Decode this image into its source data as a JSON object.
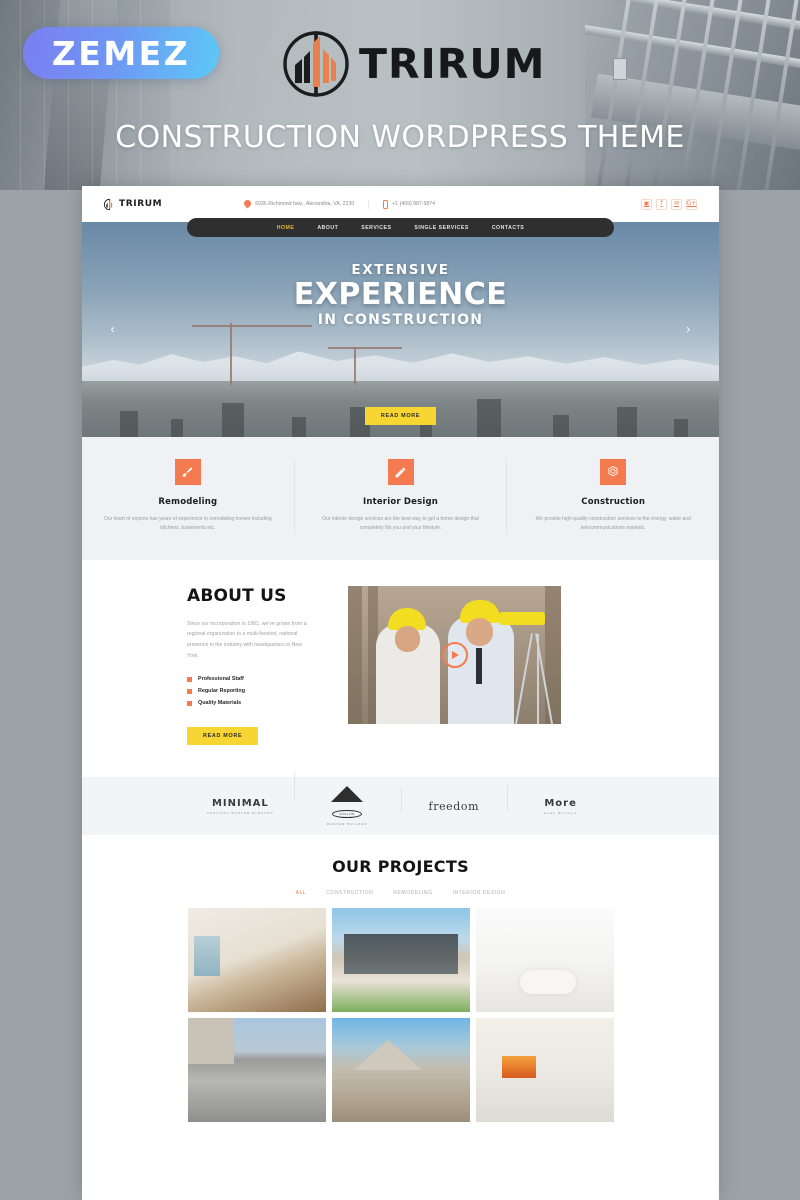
{
  "banner": {
    "vendor_badge": "ZEMEZ",
    "brand": "TRIRUM",
    "tagline": "CONSTRUCTION WORDPRESS THEME",
    "colors": {
      "badge_start": "#7B7EF0",
      "badge_end": "#5DC8F5",
      "brand_accent": "#E8814E"
    }
  },
  "site": {
    "logo_text": "TRIRUM",
    "topbar": {
      "address": "6036 Richmond hwy., Alexandria, VA, 2230",
      "phone": "+1 (409) 987-5874",
      "address_icon": "map-pin-icon",
      "phone_icon": "phone-icon",
      "socials": [
        {
          "name": "instagram-icon",
          "glyph": "▣"
        },
        {
          "name": "facebook-icon",
          "glyph": "f"
        },
        {
          "name": "twitter-icon",
          "glyph": "✉"
        },
        {
          "name": "google-plus-icon",
          "glyph": "G+"
        }
      ]
    },
    "nav": [
      {
        "label": "HOME",
        "active": true
      },
      {
        "label": "ABOUT",
        "active": false
      },
      {
        "label": "SERVICES",
        "active": false
      },
      {
        "label": "SINGLE SERVICES",
        "active": false
      },
      {
        "label": "CONTACTS",
        "active": false
      }
    ],
    "hero": {
      "line1": "EXTENSIVE",
      "line2": "EXPERIENCE",
      "line3": "IN CONSTRUCTION",
      "cta": "READ MORE",
      "prev_icon": "chevron-left-icon",
      "next_icon": "chevron-right-icon",
      "cta_color": "#F7D633"
    },
    "services": [
      {
        "icon": "paint-brush-icon",
        "title": "Remodeling",
        "text": "Our team of experts has years of experience in remodeling homes including kitchens, basements etc."
      },
      {
        "icon": "pencil-icon",
        "title": "Interior Design",
        "text": "Our interior design services are the best way to get a home design that completely fits you and your lifestyle."
      },
      {
        "icon": "gear-icon",
        "title": "Construction",
        "text": "We provide high-quality construction services to the energy, water and telecommunications markets."
      }
    ],
    "about": {
      "title": "ABOUT US",
      "text": "Since our incorporation in 1981, we've grown from a regional organization to a multi-faceted, national presence in the industry with headquarters in New York.",
      "bullets": [
        "Professional Staff",
        "Regular Reporting",
        "Quality Materials"
      ],
      "cta": "READ MORE",
      "media_icon": "play-icon"
    },
    "partners": [
      {
        "name": "MINIMAL",
        "sub": "FESTIVAL·MASTER·ELECTRO",
        "style": "sans"
      },
      {
        "name": "AVALON",
        "sub": "MASTER BUILDER",
        "style": "roof"
      },
      {
        "name": "freedom",
        "sub": "",
        "style": "serif"
      },
      {
        "name": "More",
        "sub": "Home Builders",
        "style": "sans"
      }
    ],
    "projects": {
      "title": "OUR PROJECTS",
      "filters": [
        {
          "label": "ALL",
          "active": true
        },
        {
          "label": "CONSTRUCTION",
          "active": false
        },
        {
          "label": "REMODELING",
          "active": false
        },
        {
          "label": "INTERIOR DESIGN",
          "active": false
        }
      ],
      "items": [
        {
          "alt": "empty-room-wood-floor"
        },
        {
          "alt": "modern-house-glass-facade"
        },
        {
          "alt": "white-bathroom-freestanding-tub"
        },
        {
          "alt": "concrete-architecture-exterior"
        },
        {
          "alt": "house-under-construction-scaffolding"
        },
        {
          "alt": "kitchen-with-fireplace"
        }
      ]
    }
  }
}
